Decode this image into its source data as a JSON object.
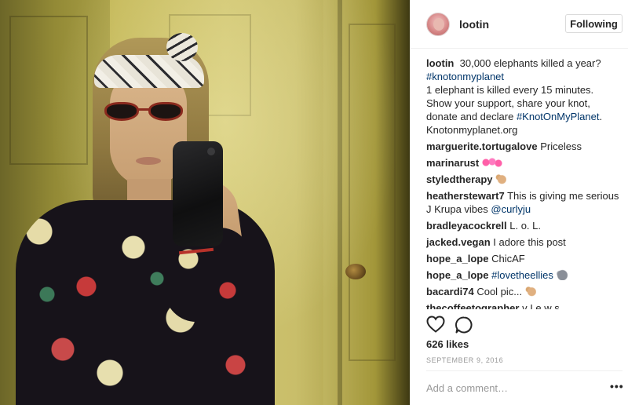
{
  "post": {
    "author": "lootin",
    "follow_label": "Following",
    "caption": {
      "user": "lootin",
      "parts": [
        {
          "text": "30,000 elephants killed a year?\n",
          "tag": false
        },
        {
          "text": "#knotonmyplanet",
          "tag": true
        },
        {
          "text": "\n1 elephant is killed every 15 minutes.\nShow your support, share your knot,\ndonate and declare ",
          "tag": false
        },
        {
          "text": "#KnotOnMyPlanet",
          "tag": true
        },
        {
          "text": ".\nKnotonmyplanet.org",
          "tag": false
        }
      ]
    },
    "comments": [
      {
        "user": "marguerite.tortugalove",
        "parts": [
          {
            "text": "Priceless",
            "tag": false
          }
        ]
      },
      {
        "user": "marinarust",
        "parts": [],
        "emoji": "hearts-emoji"
      },
      {
        "user": "styledtherapy",
        "parts": [],
        "emoji": "ok-hand-emoji"
      },
      {
        "user": "heatherstewart7",
        "parts": [
          {
            "text": "This is giving me serious J Krupa vibes ",
            "tag": false
          },
          {
            "text": "@curlyju",
            "tag": true
          }
        ]
      },
      {
        "user": "bradleyacockrell",
        "parts": [
          {
            "text": "L. o. L.",
            "tag": false
          }
        ]
      },
      {
        "user": "jacked.vegan",
        "parts": [
          {
            "text": "I adore this post",
            "tag": false
          }
        ]
      },
      {
        "user": "hope_a_lope",
        "parts": [
          {
            "text": "ChicAF",
            "tag": false
          }
        ]
      },
      {
        "user": "hope_a_lope",
        "parts": [
          {
            "text": "#lovetheellies",
            "tag": true
          }
        ],
        "emoji": "elephant-emoji"
      },
      {
        "user": "bacardi74",
        "parts": [
          {
            "text": "Cool pic...",
            "tag": false
          }
        ],
        "emoji": "ok-hand-emoji"
      },
      {
        "user": "thecoffeetographer",
        "parts": [
          {
            "text": "v I e w s",
            "tag": false
          }
        ]
      }
    ],
    "likes": "626 likes",
    "date": "SEPTEMBER 9, 2016",
    "add_comment_placeholder": "Add a comment…",
    "more_label": "•••"
  },
  "icons": {
    "like": "heart-icon",
    "comment": "comment-bubble-icon"
  },
  "colors": {
    "link": "#003569",
    "text": "#262626",
    "muted": "#999999",
    "border": "#efefef"
  }
}
